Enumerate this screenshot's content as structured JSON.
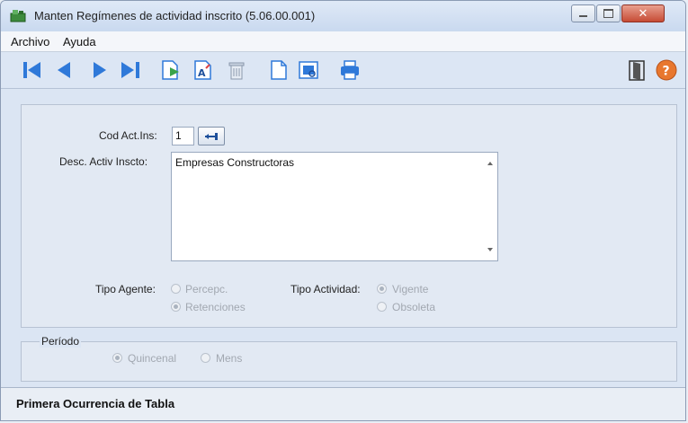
{
  "window": {
    "title": "Manten  Regímenes de actividad inscrito (5.06.00.001)"
  },
  "menu": {
    "archivo": "Archivo",
    "ayuda": "Ayuda"
  },
  "toolbar": {
    "buttons": [
      "first-record-icon",
      "previous-record-icon",
      "next-record-icon",
      "last-record-icon",
      "import-document-icon",
      "edit-text-icon",
      "delete-icon",
      "new-document-icon",
      "preview-icon",
      "print-icon",
      "exit-door-icon",
      "help-icon"
    ],
    "colors": {
      "nav_blue": "#2f79d9",
      "help_orange": "#e8772e"
    }
  },
  "form": {
    "cod_label": "Cod Act.Ins:",
    "cod_value": "1",
    "desc_label": "Desc. Activ Inscto:",
    "desc_value": "Empresas Constructoras",
    "tipo_agente_label": "Tipo Agente:",
    "tipo_agente_options": [
      {
        "label": "Percepc.",
        "selected": false
      },
      {
        "label": "Retenciones",
        "selected": true
      }
    ],
    "tipo_actividad_label": "Tipo Actividad:",
    "tipo_actividad_options": [
      {
        "label": "Vigente",
        "selected": true
      },
      {
        "label": "Obsoleta",
        "selected": false
      }
    ]
  },
  "periodo": {
    "legend": "Período",
    "options": [
      {
        "label": "Quincenal",
        "selected": true
      },
      {
        "label": "Mens",
        "selected": false
      }
    ]
  },
  "status": {
    "text": "Primera Ocurrencia de Tabla"
  }
}
